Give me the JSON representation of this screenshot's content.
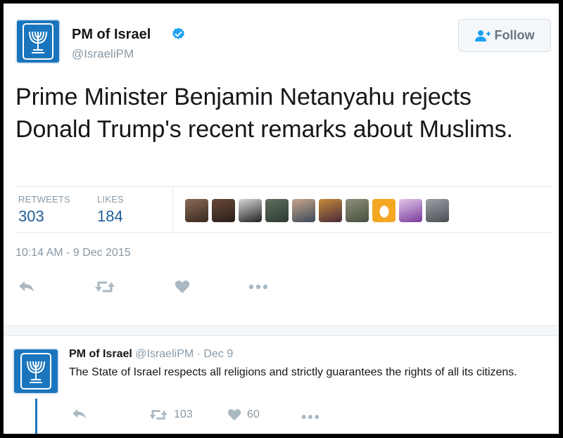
{
  "tweet": {
    "author": {
      "name": "PM of Israel",
      "handle": "@IsraeliPM",
      "verified": true
    },
    "follow_label": "Follow",
    "text": "Prime Minister Benjamin Netanyahu rejects Donald Trump's recent remarks about Muslims.",
    "stats": {
      "retweets_label": "RETWEETS",
      "retweets": "303",
      "likes_label": "LIKES",
      "likes": "184"
    },
    "timestamp": "10:14 AM - 9 Dec 2015",
    "actions": [
      "reply-icon",
      "retweet-icon",
      "like-icon",
      "more-icon"
    ]
  },
  "reply": {
    "name": "PM of Israel",
    "handle": "@IsraeliPM",
    "dot": "·",
    "date": "Dec 9",
    "text": "The State of Israel respects all religions and strictly guarantees the rights of all its citizens.",
    "retweets": "103",
    "likes": "60"
  },
  "colors": {
    "brand_blue": "#1a75bd",
    "link_blue": "#1f5e98",
    "muted": "#8899a6",
    "icon_gray": "#aab8c2",
    "verified": "#1da1f2"
  }
}
